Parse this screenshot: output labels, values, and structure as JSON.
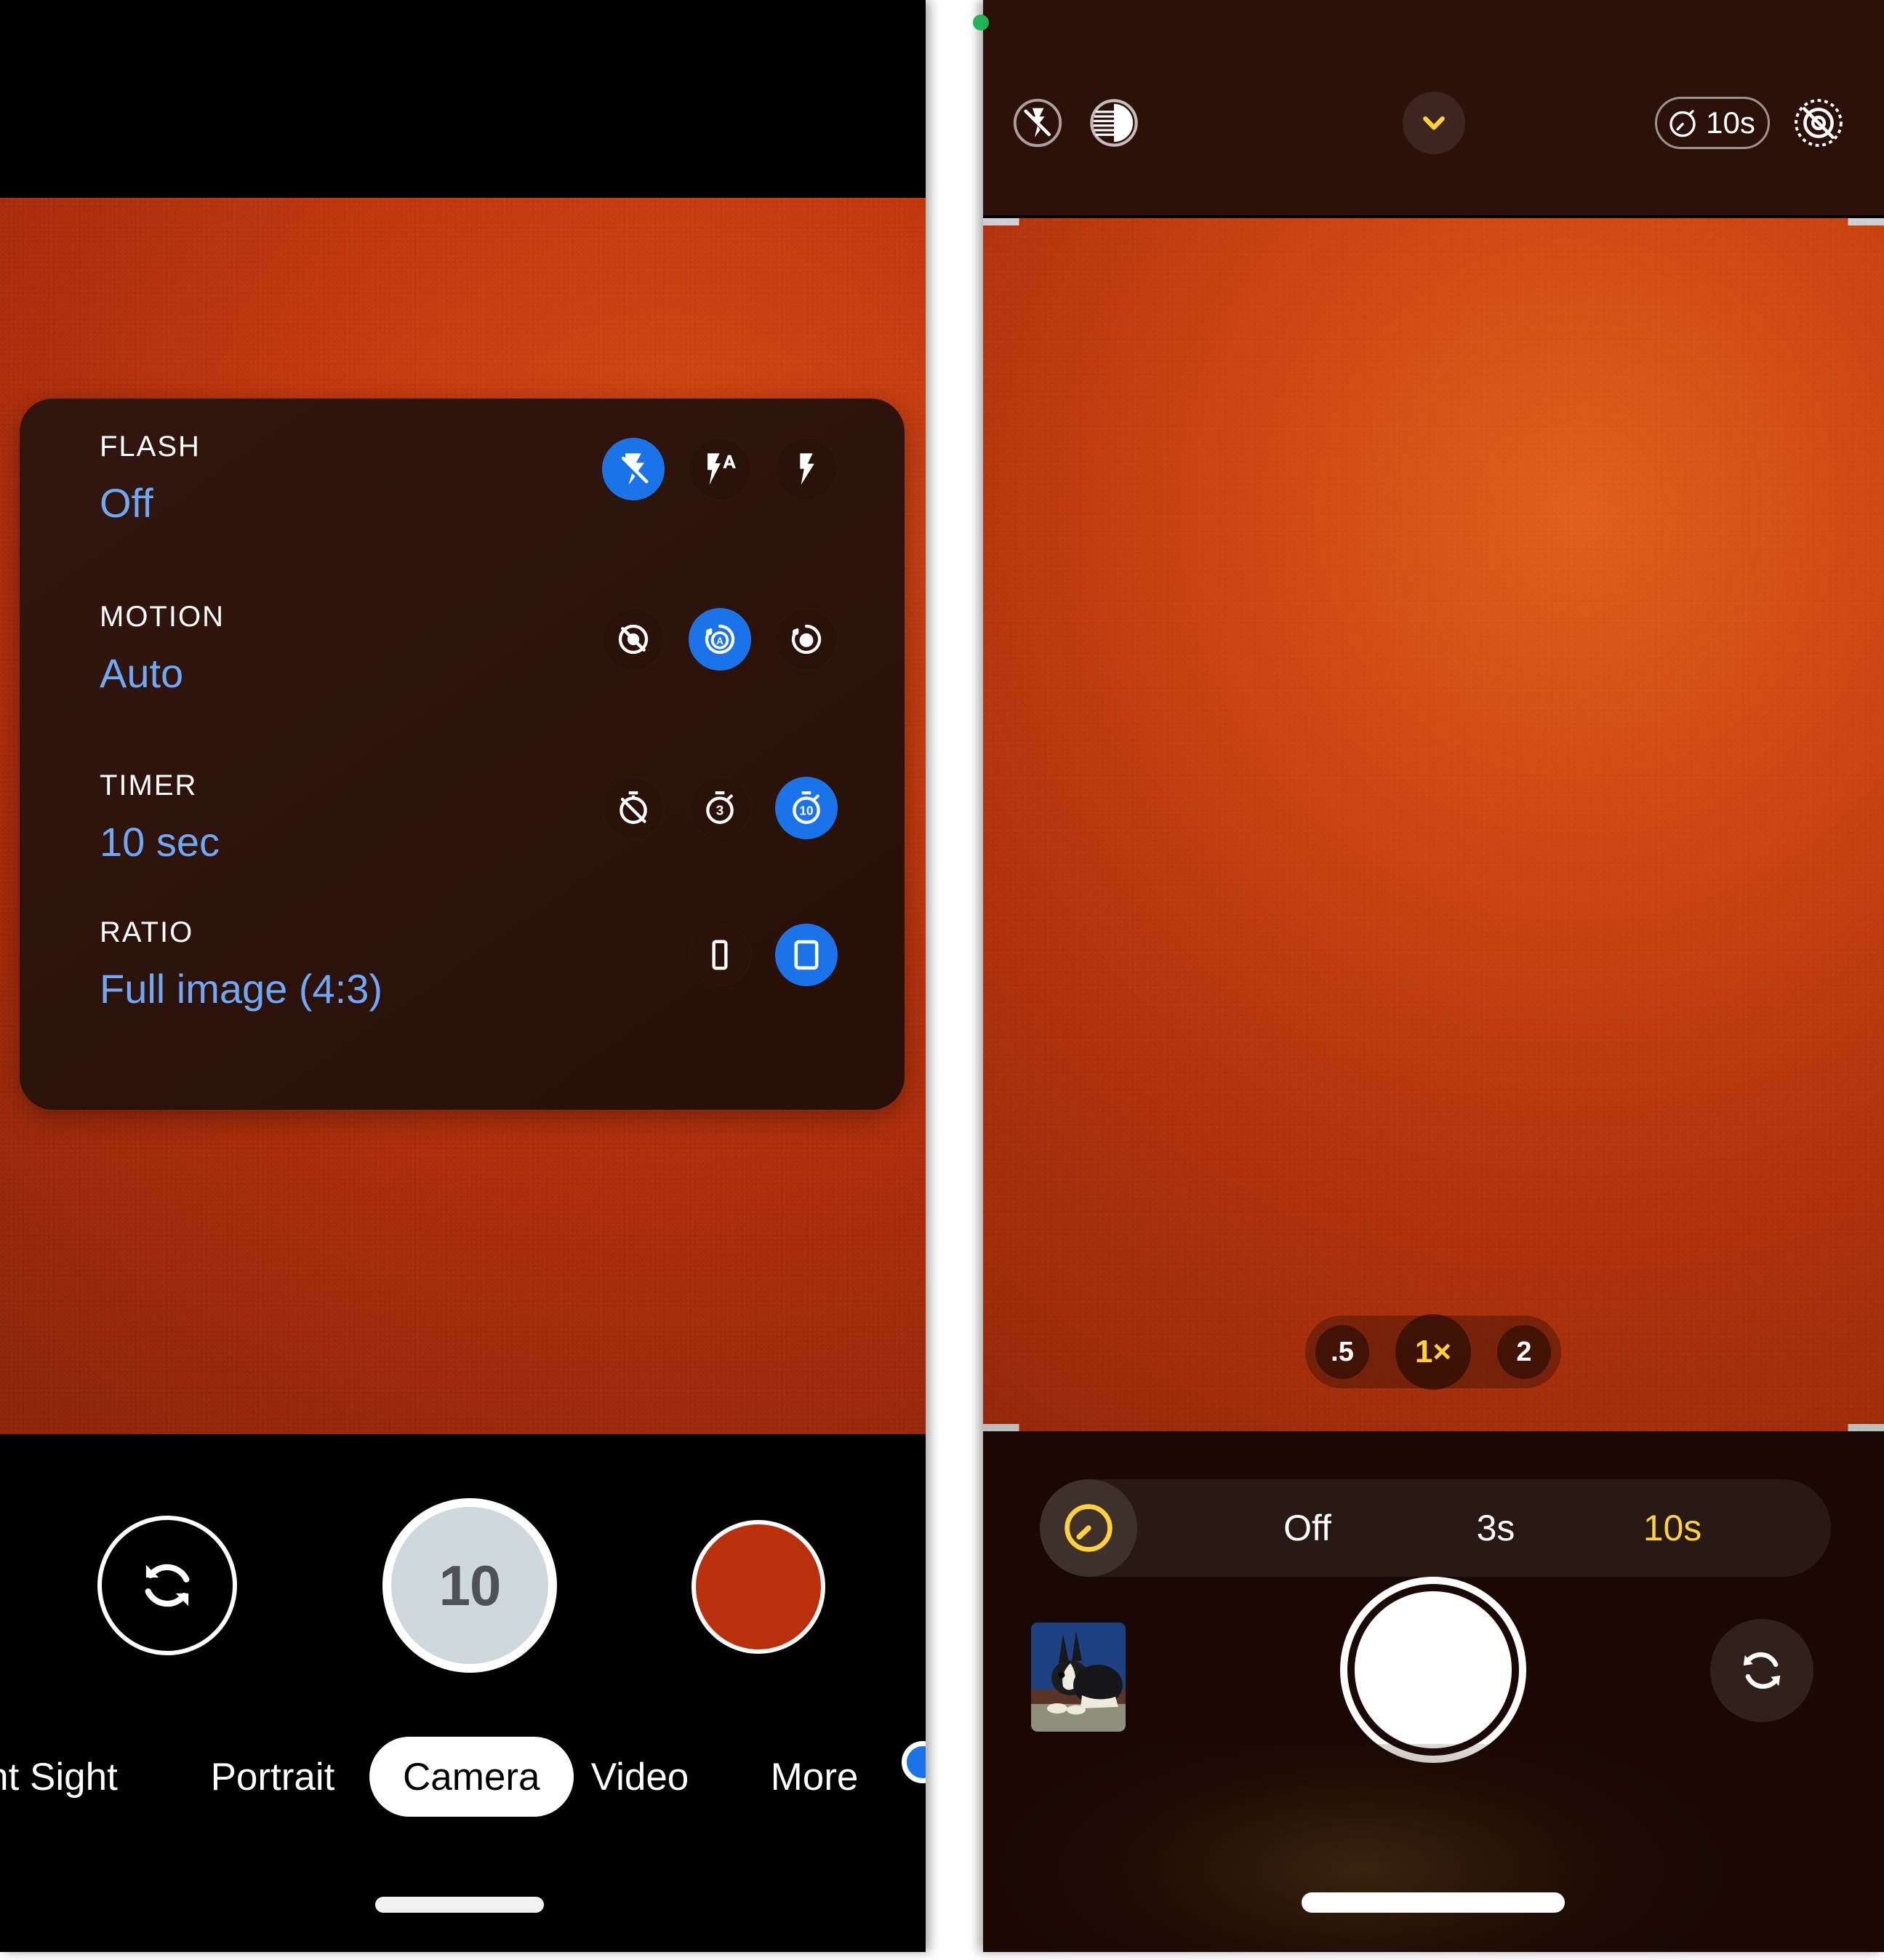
{
  "colors": {
    "accent_blue": "#1a73e8",
    "value_blue": "#6ea8f7",
    "accent_yellow": "#ffd23a",
    "card_bg": "#2c1109",
    "viewfinder_orange": "#c3390f",
    "privacy_green": "#23b355",
    "record_red": "#ba2f0c"
  },
  "left_phone": {
    "settings_card": {
      "rows": [
        {
          "label": "FLASH",
          "value": "Off",
          "options": [
            {
              "icon": "flash-off-icon",
              "selected": true
            },
            {
              "icon": "flash-auto-icon",
              "selected": false
            },
            {
              "icon": "flash-on-icon",
              "selected": false
            }
          ]
        },
        {
          "label": "MOTION",
          "value": "Auto",
          "options": [
            {
              "icon": "motion-off-icon",
              "selected": false
            },
            {
              "icon": "motion-auto-icon",
              "selected": true
            },
            {
              "icon": "motion-on-icon",
              "selected": false
            }
          ]
        },
        {
          "label": "TIMER",
          "value": "10 sec",
          "options": [
            {
              "icon": "timer-off-icon",
              "selected": false
            },
            {
              "icon": "timer-3s-icon",
              "selected": false
            },
            {
              "icon": "timer-10s-icon",
              "selected": true
            }
          ]
        },
        {
          "label": "RATIO",
          "value": "Full image (4:3)",
          "options": [
            {
              "icon": "ratio-9-16-icon",
              "selected": false
            },
            {
              "icon": "ratio-4-3-icon",
              "selected": true
            }
          ]
        }
      ],
      "settings_gear": "gear-icon"
    },
    "controls": {
      "flip_camera": "camera-flip-icon",
      "shutter_countdown": "10",
      "record_button": "record-button"
    },
    "mode_tabs": [
      {
        "label": "ht Sight",
        "active": false
      },
      {
        "label": "Portrait",
        "active": false
      },
      {
        "label": "Camera",
        "active": true
      },
      {
        "label": "Video",
        "active": false
      },
      {
        "label": "More",
        "active": false
      }
    ]
  },
  "right_phone": {
    "privacy_indicator": "camera-active-dot",
    "top_bar": {
      "flash_icon": "flash-off-icon",
      "brightness_icon": "brightness-contrast-icon",
      "expand_icon": "chevron-down-icon",
      "timer_chip": {
        "icon": "timer-icon",
        "label": "10s"
      },
      "motion_icon": "motion-off-icon"
    },
    "zoom_pills": [
      {
        "label": ".5",
        "selected": false
      },
      {
        "label": "1×",
        "selected": true
      },
      {
        "label": "2",
        "selected": false
      }
    ],
    "timer_bar": {
      "icon": "timer-icon",
      "options": [
        {
          "label": "Off",
          "selected": false
        },
        {
          "label": "3s",
          "selected": false
        },
        {
          "label": "10s",
          "selected": true
        }
      ]
    },
    "bottom": {
      "thumbnail": "gallery-thumbnail-rabbit",
      "shutter": "shutter-button",
      "flip_camera": "camera-flip-icon"
    }
  }
}
